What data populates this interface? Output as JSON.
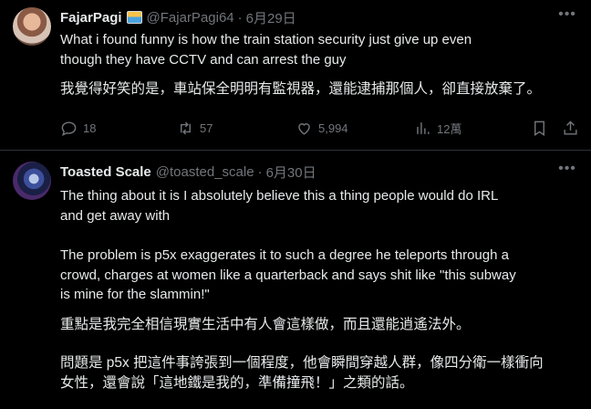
{
  "tweets": [
    {
      "author_name": "FajarPagi",
      "handle": "@FajarPagi64",
      "separator": "·",
      "date": "6月29日",
      "text_en": "What i found funny is how the train station security just give up even\nthough they have CCTV and can arrest the guy",
      "text_zh": "我覺得好笑的是，車站保全明明有監視器，還能逮捕那個人，卻直接放棄了。",
      "actions": {
        "replies": "18",
        "retweets": "57",
        "likes": "5,994",
        "views": "12萬"
      }
    },
    {
      "author_name": "Toasted Scale",
      "handle": "@toasted_scale",
      "separator": "·",
      "date": "6月30日",
      "paragraphs": [
        "The thing about it is I absolutely believe this a thing people would do IRL\nand get away with",
        "The problem is p5x exaggerates it to such a degree he teleports through a\ncrowd, charges at women like a quarterback and says shit like \"this subway\nis mine for the slammin!\"",
        "重點是我完全相信現實生活中有人會這樣做，而且還能逍遙法外。",
        "問題是 p5x 把這件事誇張到一個程度，他會瞬間穿越人群，像四分衛一樣衝向\n女性，還會說「這地鐵是我的，準備撞飛！」之類的話。"
      ]
    }
  ],
  "more_icon": "more-horizontal-icon",
  "colors": {
    "background": "#000000",
    "text": "#e7e9ea",
    "muted": "#71767b",
    "divider": "#2f3336"
  }
}
